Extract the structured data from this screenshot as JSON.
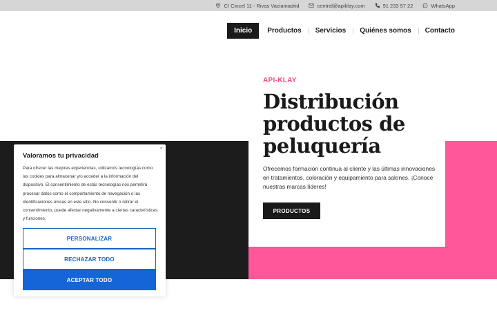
{
  "topbar": {
    "address": "C/ Cincel 11 - Rivas Vaciamadrid",
    "email": "central@apiklay.com",
    "phone": "91 233 57 22",
    "whatsapp": "WhatsApp",
    "icons": [
      "location-pin-icon",
      "mail-icon",
      "phone-icon",
      "whatsapp-icon"
    ]
  },
  "nav": {
    "items": [
      {
        "label": "Inicio"
      },
      {
        "label": "Productos"
      },
      {
        "label": "Servicios"
      },
      {
        "label": "Quiénes somos"
      },
      {
        "label": "Contacto"
      }
    ],
    "active": "Inicio"
  },
  "hero": {
    "eyebrow": "API-KLAY",
    "title_lines": [
      "Distribución",
      "productos de",
      "peluquería"
    ],
    "text": "Ofrecemos formación continua al cliente y las últimas innovaciones en tratamientos, coloración y equipamiento para salones. ¡Conoce nuestras marcas líderes!",
    "cta": "PRODUCTOS"
  },
  "cookie": {
    "title": "Valoramos tu privacidad",
    "body": "Para ofrecer las mejores experiencias, utilizamos tecnologías como las cookies para almacenar y/o acceder a la información del dispositivo. El consentimiento de estas tecnologías nos permitirá procesar datos como el comportamiento de navegación o las identificaciones únicas en este sitio. No consentir o retirar el consentimiento, puede afectar negativamente a ciertas características y funciones.",
    "close": "×",
    "buttons": {
      "customize": "PERSONALIZAR",
      "reject": "RECHAZAR TODO",
      "accept": "ACEPTAR TODO"
    }
  },
  "colors": {
    "accent_pink": "#ff5797",
    "dark": "#1c1c1c",
    "cookie_blue": "#1565d8",
    "topbar_bg": "#d6d6d6"
  }
}
